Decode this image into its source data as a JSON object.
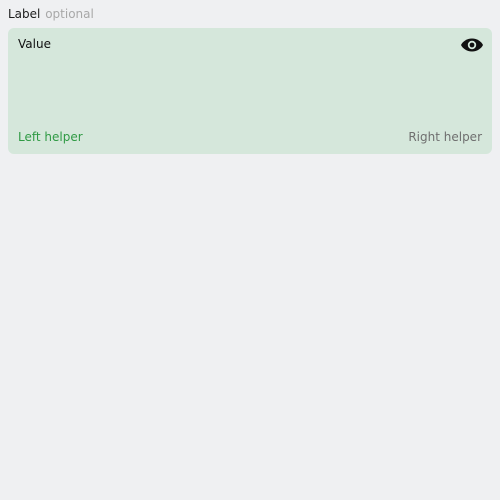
{
  "label": {
    "text": "Label",
    "optional_text": "optional"
  },
  "field": {
    "value": "Value",
    "trailing_icon": "eye-icon",
    "helper_left": "Left helper",
    "helper_right": "Right helper",
    "background_color": "#d5e7db",
    "helper_left_color": "#2f9a44"
  }
}
